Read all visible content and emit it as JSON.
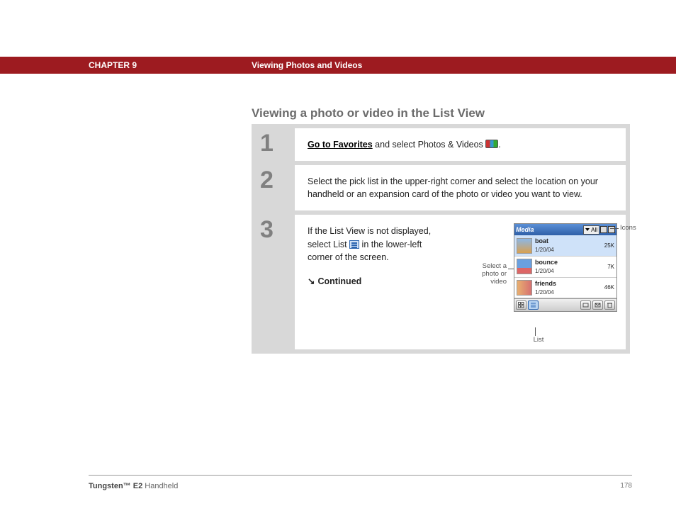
{
  "header": {
    "chapter": "CHAPTER 9",
    "title": "Viewing Photos and Videos"
  },
  "section_heading": "Viewing a photo or video in the List View",
  "steps": {
    "s1": {
      "num": "1",
      "link": "Go to Favorites",
      "rest": " and select Photos & Videos ",
      "period": "."
    },
    "s2": {
      "num": "2",
      "text": "Select the pick list in the upper-right corner and select the location on your handheld or an expansion card of the photo or video you want to view."
    },
    "s3": {
      "num": "3",
      "text_a": "If the List View is not displayed, select List ",
      "text_b": " in the lower-left corner of the screen.",
      "continued": "Continued"
    }
  },
  "device": {
    "title": "Media",
    "picklist": "All",
    "rows": [
      {
        "name": "boat",
        "date": "1/20/04",
        "size": "25K"
      },
      {
        "name": "bounce",
        "date": "1/20/04",
        "size": "7K"
      },
      {
        "name": "friends",
        "date": "1/20/04",
        "size": "46K"
      }
    ]
  },
  "callouts": {
    "icons": "Icons",
    "select": "Select a photo or video",
    "list": "List"
  },
  "footer": {
    "product_bold": "Tungsten™ E2",
    "product_rest": " Handheld",
    "page": "178"
  }
}
